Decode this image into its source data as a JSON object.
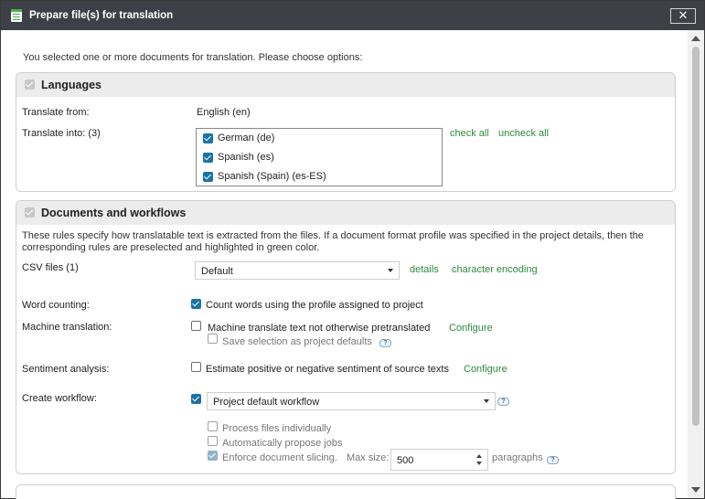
{
  "dialog": {
    "title": "Prepare file(s) for translation",
    "close_label": "✕"
  },
  "intro": "You selected one or more documents for translation. Please choose options:",
  "languages": {
    "title": "Languages",
    "translate_from_label": "Translate from:",
    "translate_from_value": "English (en)",
    "translate_into_label": "Translate into: (3)",
    "targets": [
      "German (de)",
      "Spanish (es)",
      "Spanish (Spain) (es-ES)"
    ],
    "check_all": "check all",
    "uncheck_all": "uncheck all"
  },
  "documents": {
    "title": "Documents and workflows",
    "description_line1": "These rules specify how translatable text is extracted from the files. If a document format profile was specified in the project details, then the",
    "description_line2": "corresponding rules are preselected and highlighted in green color.",
    "csv_label": "CSV files (1)",
    "csv_selected": "Default",
    "details_link": "details",
    "encoding_link": "character encoding",
    "word_counting_label": "Word counting:",
    "word_counting_option": "Count words using the profile assigned to project",
    "mt_label": "Machine translation:",
    "mt_option": "Machine translate text not otherwise pretranslated",
    "mt_configure": "Configure",
    "mt_save_defaults": "Save selection as project defaults",
    "sentiment_label": "Sentiment analysis:",
    "sentiment_option": "Estimate positive or negative sentiment of source texts",
    "sentiment_configure": "Configure",
    "workflow_label": "Create workflow:",
    "workflow_selected": "Project default workflow",
    "process_individually": "Process files individually",
    "auto_propose_jobs": "Automatically propose jobs",
    "enforce_slicing": "Enforce document slicing.",
    "max_size_label": "Max size:",
    "max_size_value": "500",
    "paragraphs_label": "paragraphs"
  },
  "help_glyph": "?",
  "colors": {
    "titlebar": "#3d4046",
    "link": "#2f8a3c",
    "checkbox": "#1a73a8"
  },
  "icons": {
    "title": "document-list-icon",
    "close": "close-icon",
    "help": "help-icon"
  }
}
